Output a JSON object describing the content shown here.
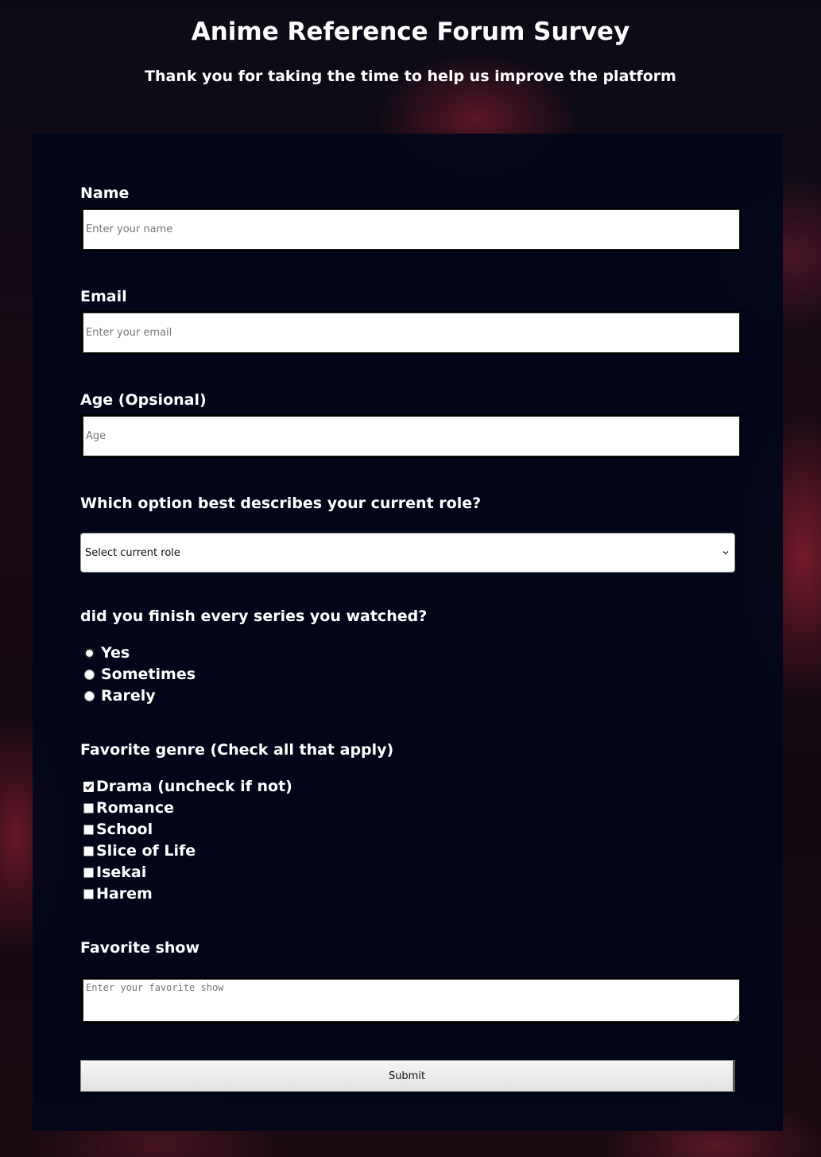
{
  "header": {
    "title": "Anime Reference Forum Survey",
    "subtitle": "Thank you for taking the time to help us improve the platform"
  },
  "form": {
    "name": {
      "label": "Name",
      "placeholder": "Enter your name",
      "value": ""
    },
    "email": {
      "label": "Email",
      "placeholder": "Enter your email",
      "value": ""
    },
    "age": {
      "label": "Age (Opsional)",
      "placeholder": "Age",
      "value": ""
    },
    "role": {
      "label": "Which option best describes your current role?",
      "selected": "Select current role",
      "icon": "chevron-down-icon"
    },
    "finish": {
      "label": "did you finish every series you watched?",
      "options": [
        {
          "label": "Yes",
          "checked": true
        },
        {
          "label": "Sometimes",
          "checked": false
        },
        {
          "label": "Rarely",
          "checked": false
        }
      ]
    },
    "genre": {
      "label": "Favorite genre (Check all that apply)",
      "options": [
        {
          "label": "Drama (uncheck if not)",
          "checked": true
        },
        {
          "label": "Romance",
          "checked": false
        },
        {
          "label": "School",
          "checked": false
        },
        {
          "label": "Slice of Life",
          "checked": false
        },
        {
          "label": "Isekai",
          "checked": false
        },
        {
          "label": "Harem",
          "checked": false
        }
      ]
    },
    "favorite_show": {
      "label": "Favorite show",
      "placeholder": "Enter your favorite show",
      "value": ""
    },
    "submit_label": "Submit"
  },
  "colors": {
    "panel": "#02061a",
    "text": "#ffffff",
    "accent_background": "#1a0a14"
  }
}
